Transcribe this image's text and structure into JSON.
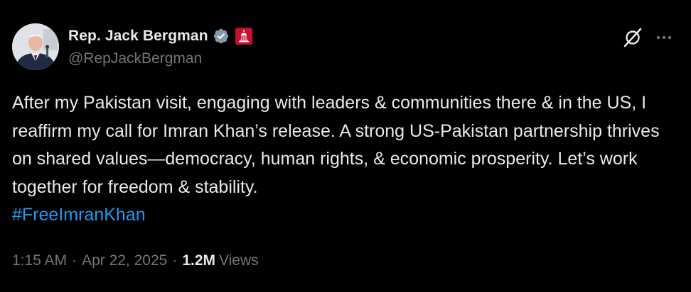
{
  "author": {
    "display_name": "Rep. Jack Bergman",
    "handle": "@RepJackBergman",
    "verified_color": "#829aab",
    "affiliation_badge_color": "#c8102e",
    "avatar_icon": "avatar-photo"
  },
  "header_actions": {
    "grok_icon": "grok-icon",
    "more_icon": "more-icon"
  },
  "tweet": {
    "body": "After my Pakistan visit, engaging with leaders & communities there & in the US, I reaffirm my call for Imran Khan’s release. A strong US-Pakistan partnership thrives on shared values—democracy, human rights, & economic prosperity. Let’s work together for freedom & stability.",
    "hashtag": "#FreeImranKhan"
  },
  "meta": {
    "time": "1:15 AM",
    "separator": "·",
    "date": "Apr 22, 2025",
    "views_count": "1.2M",
    "views_label": "Views"
  },
  "colors": {
    "background": "#000000",
    "text_primary": "#e7e9ea",
    "text_secondary": "#71767b",
    "link": "#1d9bf0"
  }
}
